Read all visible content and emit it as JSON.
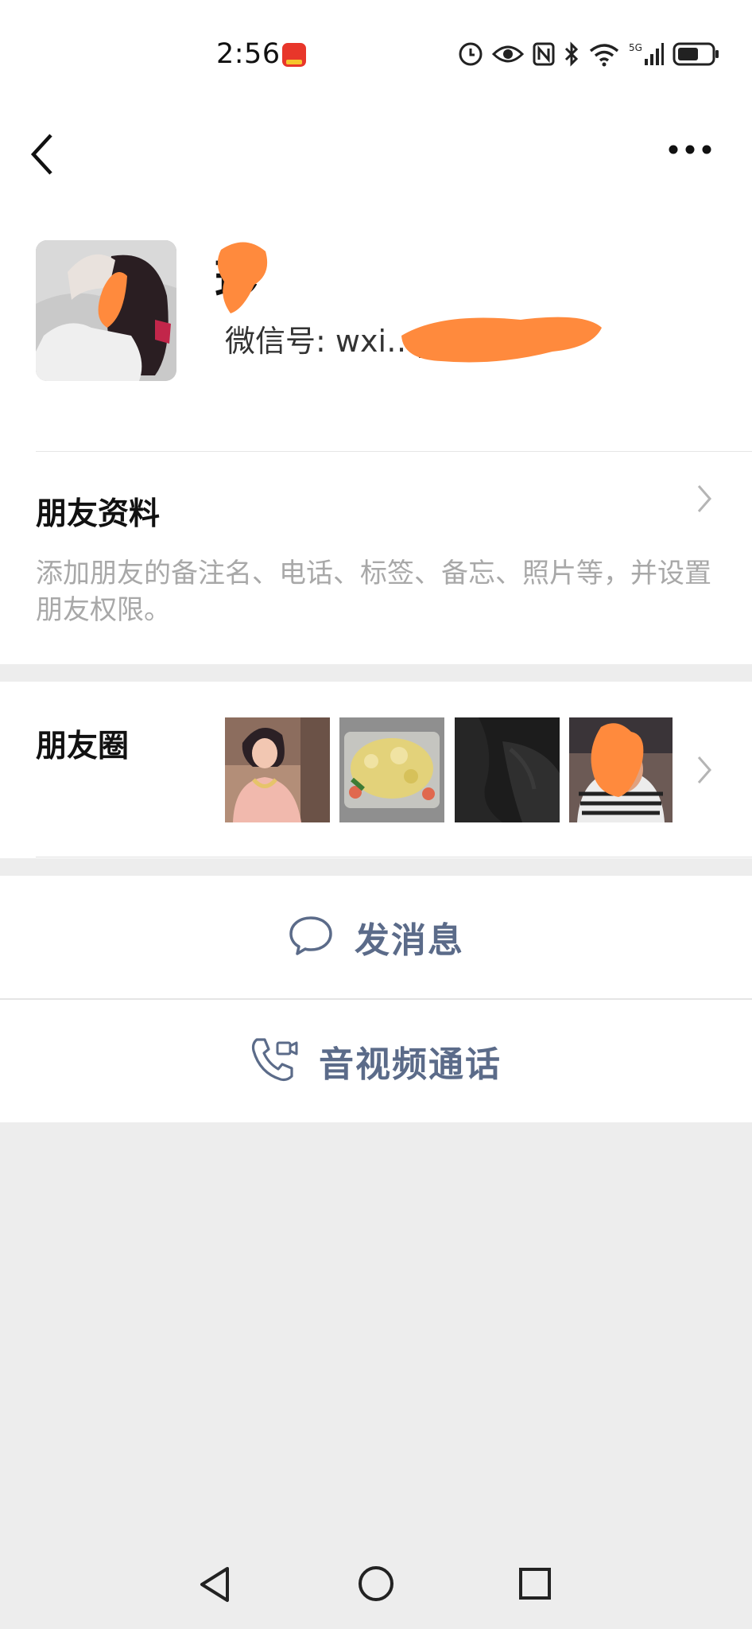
{
  "status_bar": {
    "time": "2:56",
    "icons": [
      "app-badge-icon",
      "alarm-icon",
      "eye-icon",
      "nfc-icon",
      "bluetooth-icon",
      "wifi-icon",
      "signal-5g-icon",
      "battery-icon"
    ]
  },
  "header": {
    "back_icon": "back-chevron-icon",
    "more_icon": "more-dots-icon"
  },
  "profile": {
    "name": "珍",
    "wechat_id_label": "微信号:",
    "wechat_id_value": "wxi…yk322"
  },
  "friend_info": {
    "title": "朋友资料",
    "description": "添加朋友的备注名、电话、标签、备忘、照片等，并设置朋友权限。"
  },
  "moments": {
    "title": "朋友圈",
    "photos": [
      "moments-photo-woman",
      "moments-photo-food",
      "moments-photo-dark",
      "moments-photo-person"
    ]
  },
  "actions": {
    "message_label": "发消息",
    "call_label": "音视频通话"
  },
  "navigation": {
    "icons": [
      "nav-back-icon",
      "nav-home-icon",
      "nav-recents-icon"
    ]
  },
  "colors": {
    "action_text": "#5b6b89",
    "background": "#ededed",
    "redaction": "#ff8a3d"
  }
}
